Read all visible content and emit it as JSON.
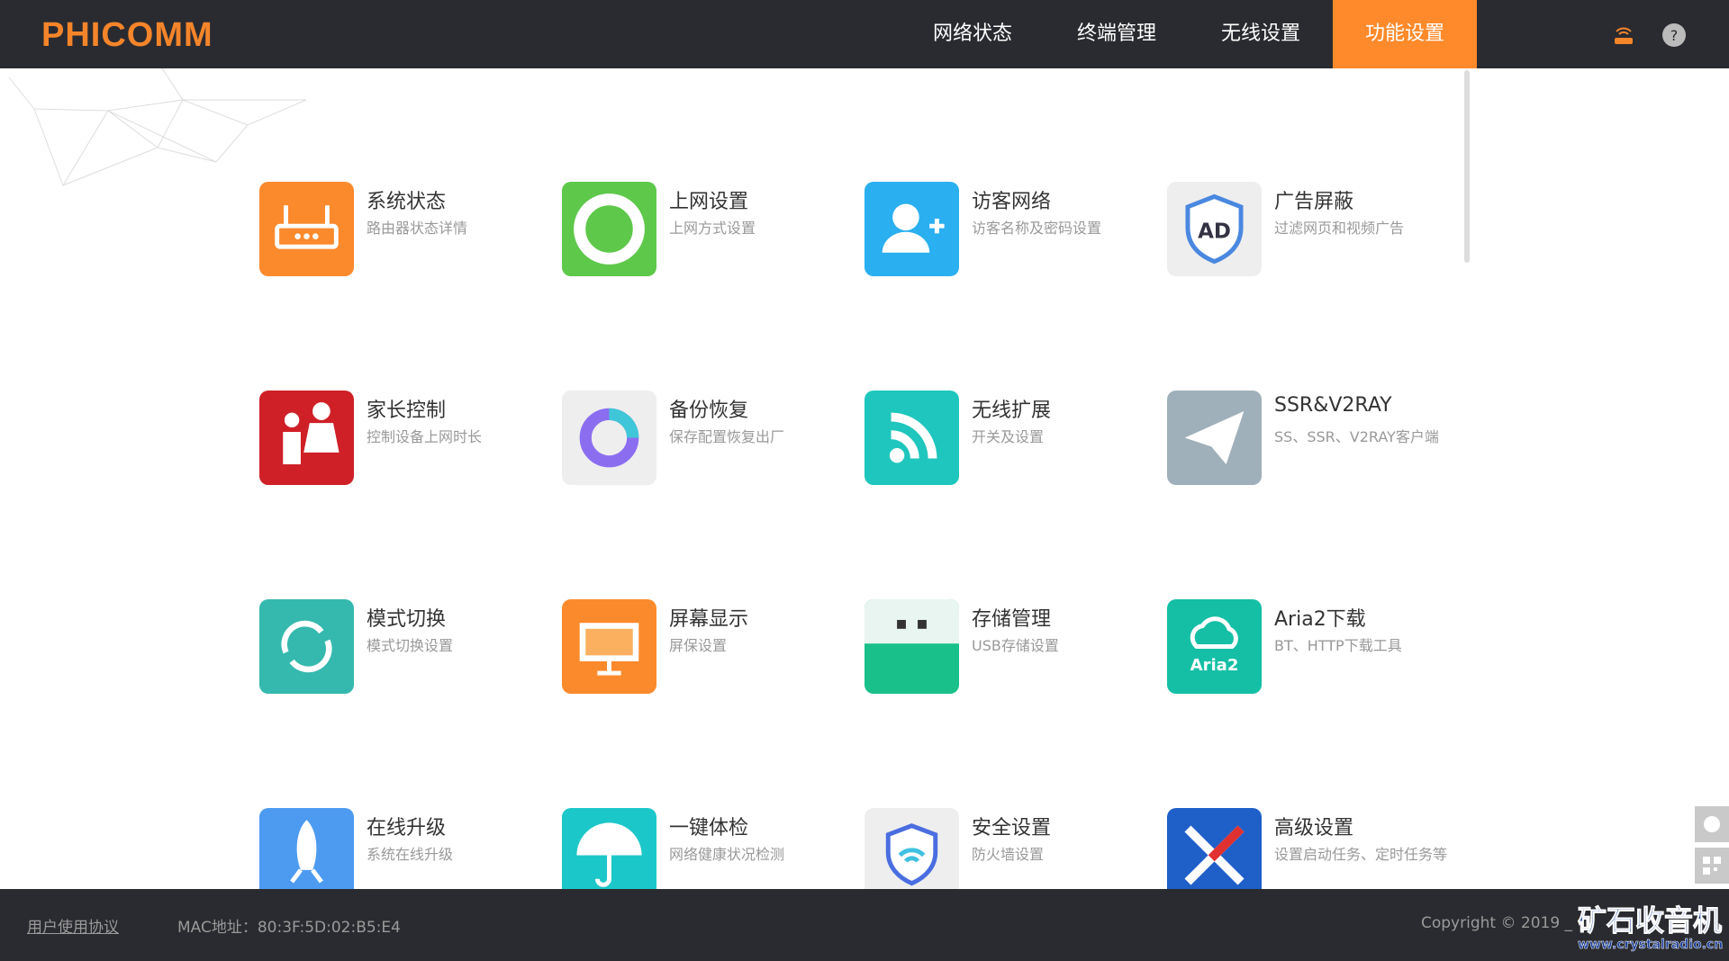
{
  "header": {
    "logo": "PHICOMM",
    "nav": [
      {
        "label": "网络状态"
      },
      {
        "label": "终端管理"
      },
      {
        "label": "无线设置"
      },
      {
        "label": "功能设置",
        "active": true
      }
    ],
    "accent": "#fe8a2b"
  },
  "tiles": [
    {
      "title": "系统状态",
      "desc": "路由器状态详情",
      "color": "#fb8a2c",
      "icon": "router-icon"
    },
    {
      "title": "上网设置",
      "desc": "上网方式设置",
      "color": "#5ec84a",
      "icon": "globe-icon"
    },
    {
      "title": "访客网络",
      "desc": "访客名称及密码设置",
      "color": "#2aaff0",
      "icon": "add-user-icon"
    },
    {
      "title": "广告屏蔽",
      "desc": "过滤网页和视频广告",
      "color": "#eeeeee",
      "icon": "ad-shield-icon"
    },
    {
      "title": "家长控制",
      "desc": "控制设备上网时长",
      "color": "#cf2027",
      "icon": "parent-child-icon"
    },
    {
      "title": "备份恢复",
      "desc": "保存配置恢复出厂",
      "color": "#eeeeee",
      "icon": "backup-ring-icon"
    },
    {
      "title": "无线扩展",
      "desc": "开关及设置",
      "color": "#1fc6bd",
      "icon": "wifi-extend-icon"
    },
    {
      "title": "SSR&V2RAY",
      "desc": "SS、SSR、V2RAY客户端",
      "color": "#9fb0ba",
      "icon": "paper-plane-icon"
    },
    {
      "title": "模式切换",
      "desc": "模式切换设置",
      "color": "#35b9ae",
      "icon": "refresh-icon"
    },
    {
      "title": "屏幕显示",
      "desc": "屏保设置",
      "color": "#fb8a2c",
      "icon": "monitor-icon"
    },
    {
      "title": "存储管理",
      "desc": "USB存储设置",
      "color": "#19c08a",
      "icon": "usb-icon"
    },
    {
      "title": "Aria2下载",
      "desc": "BT、HTTP下载工具",
      "color": "#14bfa5",
      "icon": "aria2-cloud-icon",
      "icon_text": "Aria2"
    },
    {
      "title": "在线升级",
      "desc": "系统在线升级",
      "color": "#4d9bf0",
      "icon": "rocket-icon"
    },
    {
      "title": "一键体检",
      "desc": "网络健康状况检测",
      "color": "#1cc7c9",
      "icon": "umbrella-icon"
    },
    {
      "title": "安全设置",
      "desc": "防火墙设置",
      "color": "#eeeeee",
      "icon": "wifi-shield-icon"
    },
    {
      "title": "高级设置",
      "desc": "设置启动任务、定时任务等",
      "color": "#1f5fc8",
      "icon": "tools-icon"
    }
  ],
  "footer": {
    "agreement": "用户使用协议",
    "mac": "MAC地址：80:3F:5D:02:B5:E4",
    "copyright": "Copyright © 2019 _",
    "watermark": "矿石收音机",
    "watermark_url": "www.crystalradio.cn"
  }
}
